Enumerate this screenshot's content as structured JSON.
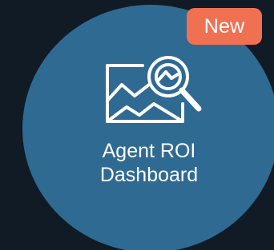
{
  "badge": {
    "text": "New"
  },
  "tile": {
    "title_line1": "Agent ROI",
    "title_line2": "Dashboard",
    "icon": "chart-magnifier-icon"
  },
  "colors": {
    "background": "#101b26",
    "tile": "#2f6a93",
    "badge": "#f07152",
    "text": "#ffffff"
  }
}
